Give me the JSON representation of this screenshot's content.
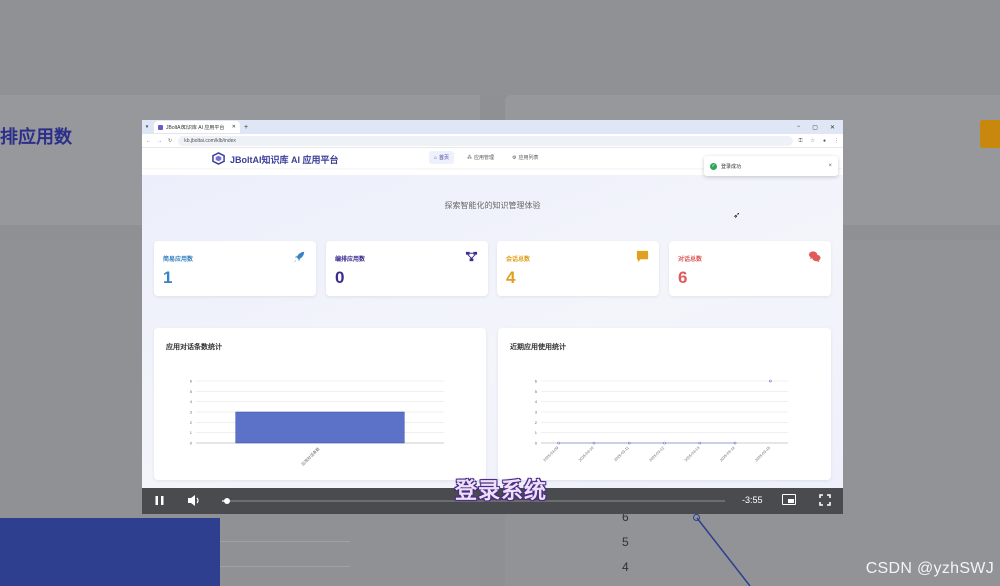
{
  "background": {
    "title": "排应用数",
    "y_ticks": [
      "6",
      "5",
      "4"
    ]
  },
  "browser": {
    "tab_title": "JBoltAI知识库 AI 应用平台",
    "tab_add": "+",
    "url": "kb.jboltai.com/klb/index",
    "window_controls": [
      "−",
      "▢",
      "✕"
    ]
  },
  "app": {
    "logo_text": "JBoltAI知识库 AI 应用平台",
    "nav": [
      {
        "label": "首页",
        "icon": "home-icon",
        "active": true
      },
      {
        "label": "应用管理",
        "icon": "apps-icon",
        "active": false
      },
      {
        "label": "应用列表",
        "icon": "list-icon",
        "active": false
      }
    ],
    "toast": {
      "text": "登录成功",
      "close": "×"
    },
    "subtitle": "探索智能化的知识管理体验"
  },
  "stats": [
    {
      "label": "简易应用数",
      "value": "1",
      "color": "#3a83c3",
      "icon": "rocket-icon"
    },
    {
      "label": "编排应用数",
      "value": "0",
      "color": "#3c2c8f",
      "icon": "flow-icon"
    },
    {
      "label": "会话总数",
      "value": "4",
      "color": "#e0a020",
      "icon": "chat-icon"
    },
    {
      "label": "对话总数",
      "value": "6",
      "color": "#e05a5a",
      "icon": "chats-icon"
    }
  ],
  "panels": {
    "left_title": "应用对话条数统计",
    "right_title": "近期应用使用统计"
  },
  "chart_data": [
    {
      "type": "bar",
      "categories": [
        "应用对话条数"
      ],
      "values": [
        3
      ],
      "ylim": [
        0,
        6
      ],
      "y_ticks": [
        "0",
        "1",
        "2",
        "3",
        "4",
        "5",
        "6"
      ],
      "grid": true,
      "title": "应用对话条数统计",
      "bar_color": "#5b72c8"
    },
    {
      "type": "line",
      "x": [
        "2025-03-09",
        "2025-03-10",
        "2025-03-11",
        "2025-03-12",
        "2025-03-13",
        "2025-03-14",
        "2025-03-15"
      ],
      "values": [
        0,
        0,
        0,
        0,
        0,
        0,
        6
      ],
      "ylim": [
        0,
        6
      ],
      "y_ticks": [
        "0",
        "1",
        "2",
        "3",
        "4",
        "5",
        "6"
      ],
      "grid": true,
      "title": "近期应用使用统计",
      "line_color": "#5b72c8"
    }
  ],
  "player": {
    "time": "-3:55",
    "progress": 0.01
  },
  "caption": "登录系统",
  "watermark": "CSDN @yzhSWJ"
}
